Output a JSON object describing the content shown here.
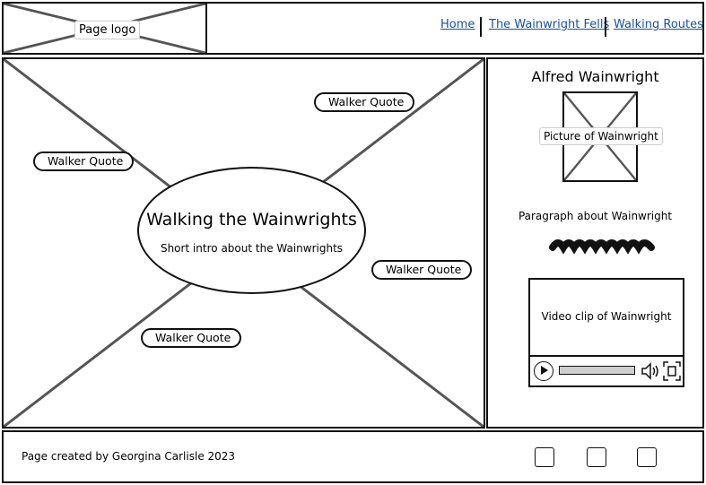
{
  "header": {
    "logo_label": "Page logo",
    "nav": [
      "Home",
      "The Wainwright Fells",
      "Walking Routes"
    ],
    "link_color": "#1b4f9c"
  },
  "hero": {
    "title": "Walking the Wainwrights",
    "intro": "Short intro about the Wainwrights",
    "quotes": [
      "Walker Quote",
      "Walker Quote",
      "Walker Quote",
      "Walker Quote"
    ]
  },
  "sidebar": {
    "title": "Alfred Wainwright",
    "picture_label": "Picture of Wainwright",
    "paragraph_label": "Paragraph about Wainwright",
    "video_label": "Video clip of Wainwright",
    "icons": [
      "play-icon",
      "volume-icon",
      "fullscreen-icon"
    ]
  },
  "footer": {
    "credit": "Page created by Georgina Carlisle 2023",
    "social_icons": [
      "social-icon-1",
      "social-icon-2",
      "social-icon-3"
    ]
  }
}
